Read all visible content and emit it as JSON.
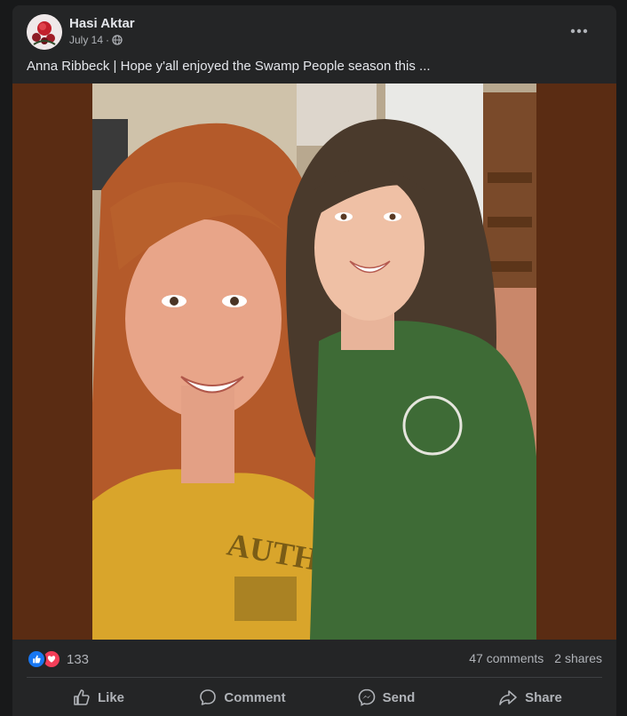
{
  "post": {
    "author": "Hasi Aktar",
    "date": "July 14",
    "separator": "·",
    "privacy_icon": "globe-icon",
    "caption": "Anna Ribbeck | Hope y'all enjoyed the Swamp People season this ..."
  },
  "stats": {
    "reaction_icons": [
      "like-icon",
      "love-icon"
    ],
    "reaction_count": "133",
    "comments": "47 comments",
    "shares": "2 shares"
  },
  "actions": [
    {
      "label": "Like",
      "icon": "thumbs-up-icon"
    },
    {
      "label": "Comment",
      "icon": "comment-icon"
    },
    {
      "label": "Send",
      "icon": "messenger-icon"
    },
    {
      "label": "Share",
      "icon": "share-icon"
    }
  ],
  "colors": {
    "background": "#18191a",
    "card": "#242526",
    "text_primary": "#e4e6eb",
    "text_secondary": "#b0b3b8",
    "like_blue": "#1877f2",
    "love_red": "#f33e58",
    "photo_padding": "#5a2c13"
  }
}
